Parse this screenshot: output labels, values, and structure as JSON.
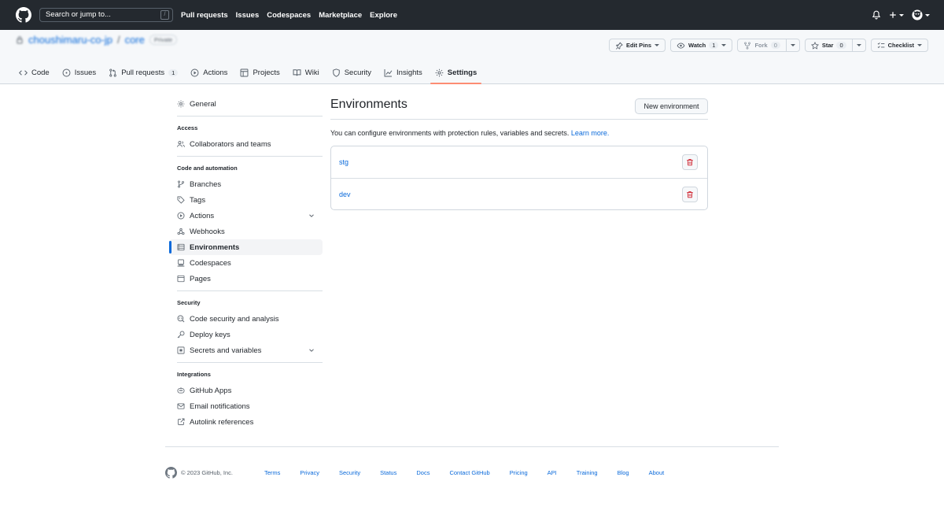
{
  "header": {
    "search_placeholder": "Search or jump to...",
    "search_shortcut": "/",
    "nav": [
      "Pull requests",
      "Issues",
      "Codespaces",
      "Marketplace",
      "Explore"
    ]
  },
  "repo": {
    "owner": "choushimaru-co-jp",
    "separator": "/",
    "name": "core",
    "visibility": "Private",
    "actions": {
      "edit_pins": "Edit Pins",
      "watch": "Watch",
      "watch_count": "1",
      "fork": "Fork",
      "fork_count": "0",
      "star": "Star",
      "star_count": "0",
      "list": "Checklist"
    }
  },
  "repo_nav": {
    "code": "Code",
    "issues": "Issues",
    "pull_requests": "Pull requests",
    "pull_requests_count": "1",
    "actions": "Actions",
    "projects": "Projects",
    "wiki": "Wiki",
    "security": "Security",
    "insights": "Insights",
    "settings": "Settings"
  },
  "sidebar": {
    "general": "General",
    "access_heading": "Access",
    "collaborators": "Collaborators and teams",
    "code_heading": "Code and automation",
    "branches": "Branches",
    "tags": "Tags",
    "actions": "Actions",
    "webhooks": "Webhooks",
    "environments": "Environments",
    "codespaces": "Codespaces",
    "pages": "Pages",
    "security_heading": "Security",
    "code_security": "Code security and analysis",
    "deploy_keys": "Deploy keys",
    "secrets": "Secrets and variables",
    "integrations_heading": "Integrations",
    "github_apps": "GitHub Apps",
    "email_notifications": "Email notifications",
    "autolink": "Autolink references"
  },
  "main": {
    "title": "Environments",
    "new_button": "New environment",
    "description": "You can configure environments with protection rules, variables and secrets.",
    "learn_more": "Learn more.",
    "environments": [
      "stg",
      "dev"
    ]
  },
  "footer": {
    "copyright": "© 2023 GitHub, Inc.",
    "links": [
      "Terms",
      "Privacy",
      "Security",
      "Status",
      "Docs",
      "Contact GitHub",
      "Pricing",
      "API",
      "Training",
      "Blog",
      "About"
    ]
  },
  "colors": {
    "header_bg": "#24292f",
    "link": "#0969da",
    "danger": "#cf222e",
    "active_tab": "#fd8c73"
  }
}
